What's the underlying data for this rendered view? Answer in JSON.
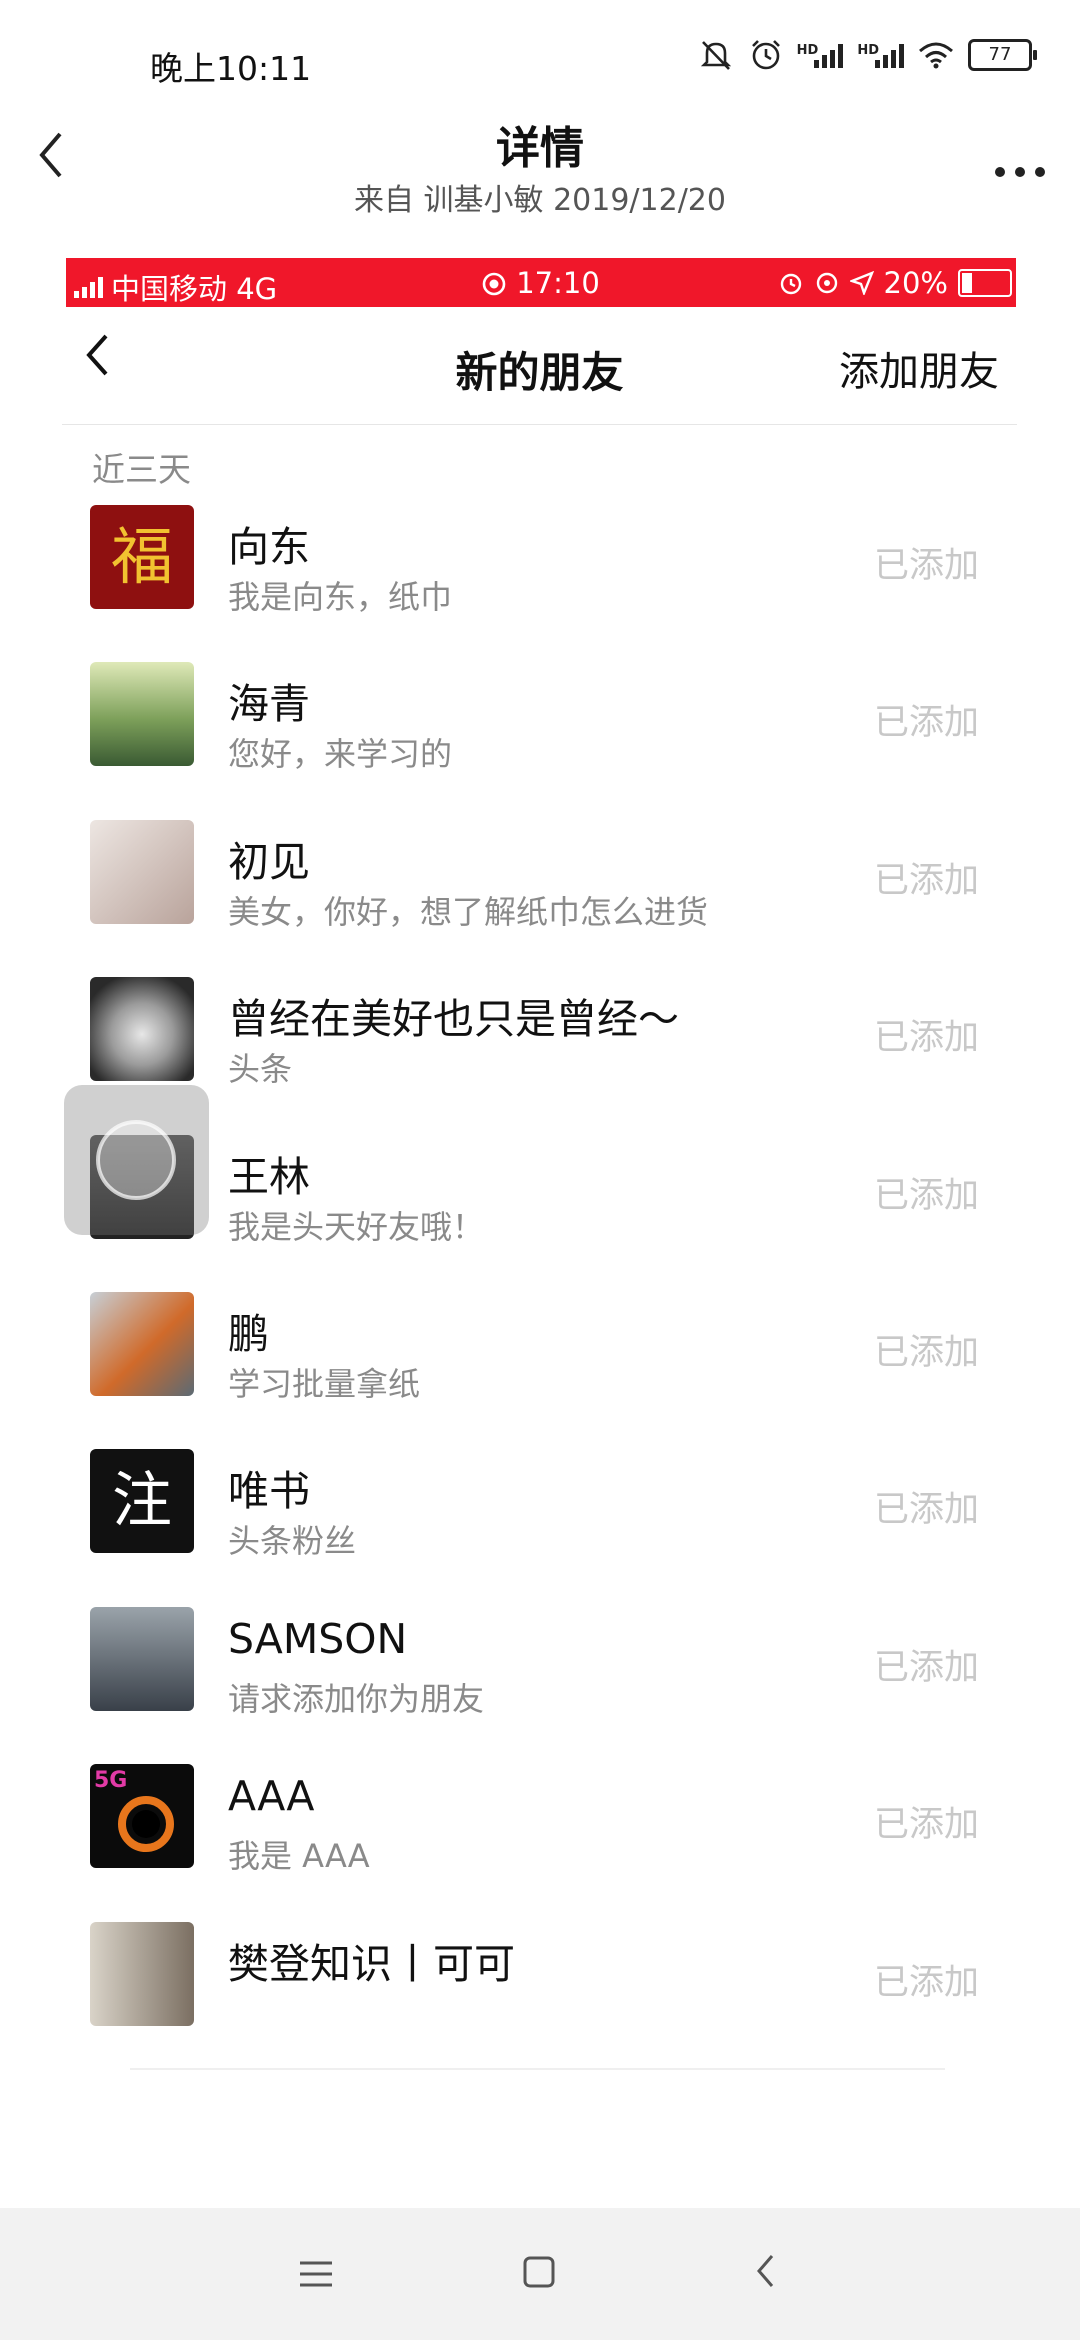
{
  "status_bar": {
    "time": "晚上10:11",
    "battery": "77",
    "icons": [
      "mute-icon",
      "alarm-icon",
      "hd-signal-icon",
      "hd-signal-icon",
      "wifi-icon",
      "battery-icon"
    ]
  },
  "header": {
    "title": "详情",
    "subtitle": "来自 训基小敏 2019/12/20",
    "back_icon": "chevron-left-icon",
    "more_icon": "more-dots-icon"
  },
  "embedded": {
    "status_bar": {
      "carrier": "中国移动 4G",
      "time": "17:10",
      "battery": "20%"
    },
    "nav": {
      "title": "新的朋友",
      "action": "添加朋友"
    },
    "section_label": "近三天",
    "friends": [
      {
        "name": "向东",
        "message": "我是向东，纸巾",
        "status": "已添加",
        "avatar_char": "福"
      },
      {
        "name": "海青",
        "message": "您好，来学习的",
        "status": "已添加"
      },
      {
        "name": "初见",
        "message": "美女，你好，想了解纸巾怎么进货",
        "status": "已添加"
      },
      {
        "name": "曾经在美好也只是曾经～",
        "message": "头条",
        "status": "已添加"
      },
      {
        "name": "王林",
        "message": "我是头天好友哦！",
        "status": "已添加"
      },
      {
        "name": "鹏",
        "message": "学习批量拿纸",
        "status": "已添加"
      },
      {
        "name": "唯书",
        "message": "头条粉丝",
        "status": "已添加",
        "avatar_char": "注"
      },
      {
        "name": "SAMSON",
        "message": "请求添加你为朋友",
        "status": "已添加"
      },
      {
        "name": "AAA",
        "message": "我是 AAA",
        "status": "已添加",
        "avatar_char": "5G"
      },
      {
        "name": "樊登知识丨可可",
        "message": "",
        "status": "已添加"
      }
    ]
  },
  "navbar": {
    "menu_icon": "menu-icon",
    "home_icon": "home-square-icon",
    "back_icon": "back-triangle-icon"
  }
}
